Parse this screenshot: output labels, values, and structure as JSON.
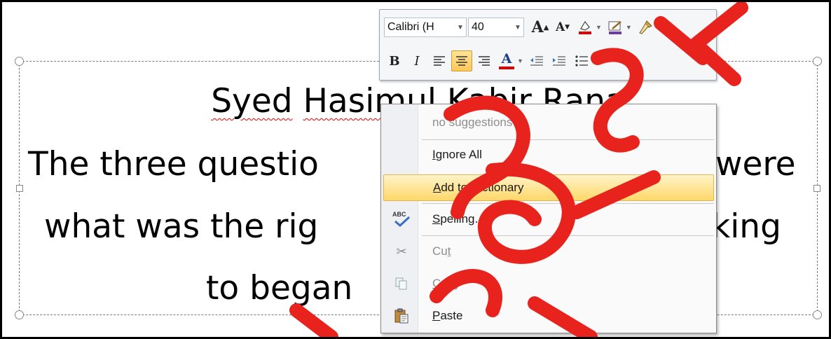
{
  "slide": {
    "title_line": "Syed Hasimul Kabir Rana",
    "title_misspelled_a": "Syed",
    "title_misspelled_b": "Hasimul",
    "title_rest": " Kabir Rana",
    "line2_left": "The three questio",
    "line2_right": "were",
    "line3_left": "what was the rig",
    "line3_right": "king",
    "line4_left": "to began"
  },
  "mini_toolbar": {
    "font_name": "Calibri (H",
    "font_size": "40",
    "grow_font_label": "A",
    "shrink_font_label": "A",
    "bold_label": "B",
    "italic_label": "I",
    "font_color_label": "A",
    "icons": [
      "grow-font-icon",
      "shrink-font-icon",
      "highlight-icon",
      "line-color-icon",
      "format-painter-icon",
      "align-left-icon",
      "align-center-icon",
      "align-right-icon",
      "font-color-icon",
      "decrease-indent-icon",
      "increase-indent-icon",
      "bullets-icon"
    ]
  },
  "context_menu": {
    "no_suggestions": "no suggestions",
    "ignore_all": "Ignore All",
    "add_to_dictionary": "Add to Dictionary",
    "spelling": "Spelling...",
    "cut": "Cut",
    "copy": "Copy",
    "paste": "Paste",
    "spelling_icon_text": "ABC"
  },
  "colors": {
    "squiggle": "#e00000",
    "hover_top": "#fff3c7",
    "hover_bottom": "#ffd86a",
    "watermark": "#e8231e",
    "font_color_bar": "#e00000"
  }
}
